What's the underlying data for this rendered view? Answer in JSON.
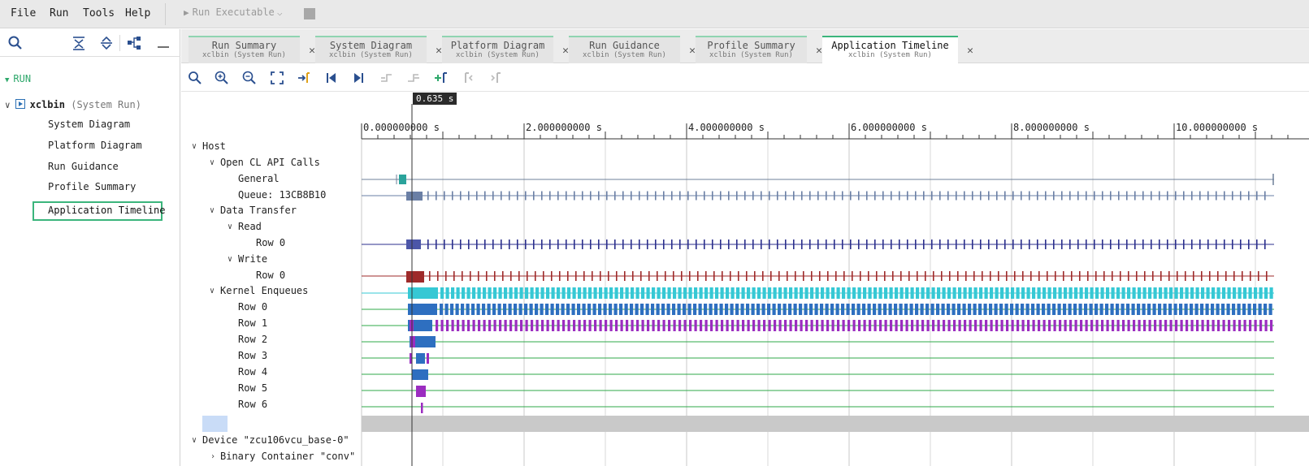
{
  "menubar": {
    "items": [
      "File",
      "Run",
      "Tools",
      "Help"
    ],
    "run_executable": "Run Executable"
  },
  "left_panel": {
    "run_label": "RUN",
    "xclbin_name": "xclbin",
    "xclbin_sub": "(System Run)",
    "items": [
      "System Diagram",
      "Platform Diagram",
      "Run Guidance",
      "Profile Summary",
      "Application Timeline"
    ],
    "selected": "Application Timeline"
  },
  "tabs": [
    {
      "title": "Run Summary",
      "subtitle": "xclbin (System Run)"
    },
    {
      "title": "System Diagram",
      "subtitle": "xclbin (System Run)"
    },
    {
      "title": "Platform Diagram",
      "subtitle": "xclbin (System Run)"
    },
    {
      "title": "Run Guidance",
      "subtitle": "xclbin (System Run)"
    },
    {
      "title": "Profile Summary",
      "subtitle": "xclbin (System Run)"
    },
    {
      "title": "Application Timeline",
      "subtitle": "xclbin (System Run)",
      "active": true
    }
  ],
  "timeline": {
    "cursor_label": "0.635 s",
    "cursor_time_s": 0.635,
    "ruler": {
      "major_ticks": [
        "0.000000000 s",
        "2.000000000 s",
        "4.000000000 s",
        "6.000000000 s",
        "8.000000000 s",
        "10.000000000 s"
      ],
      "major_values_s": [
        0,
        2,
        4,
        6,
        8,
        10
      ]
    },
    "tree": {
      "host": "Host",
      "opencl_api_calls": "Open CL API Calls",
      "general": "General",
      "queue": "Queue: 13CB8B10",
      "data_transfer": "Data Transfer",
      "read": "Read",
      "read_row": "Row 0",
      "write": "Write",
      "write_row": "Row 0",
      "kernel_enqueues": "Kernel Enqueues",
      "kernel_rows": [
        "Row 0",
        "Row 1",
        "Row 2",
        "Row 3",
        "Row 4",
        "Row 5",
        "Row 6"
      ],
      "device": "Device \"zcu106vcu_base-0\"",
      "binary_container": "Binary Container \"conv\""
    },
    "colors": {
      "general": "#2aa39b",
      "queue": "#6a7fa5",
      "read": "#2b2f8c",
      "write": "#9e2a2a",
      "kernel_header": "#36c8d4",
      "kernel_row0": "#2e6fc0",
      "kernel_row1": "#9b2dc0",
      "kernel_line": "#2fa84a",
      "accent": "#3bb57c"
    }
  }
}
